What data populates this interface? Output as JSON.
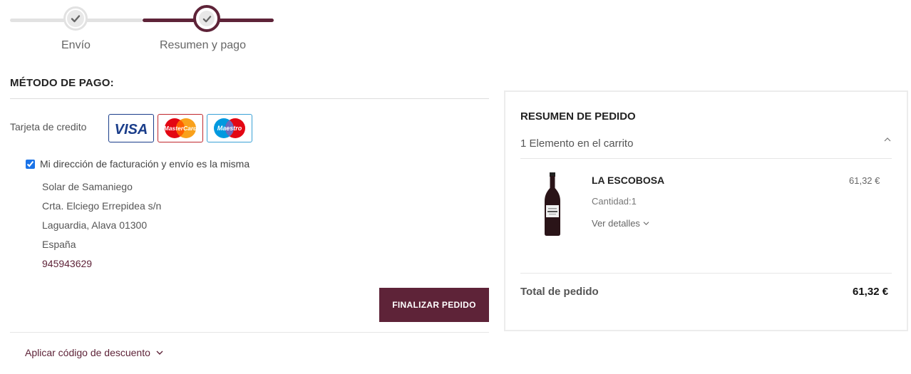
{
  "steps": [
    {
      "label": "Envío",
      "status": "complete",
      "icon": "check-icon"
    },
    {
      "label": "Resumen y pago",
      "status": "current",
      "icon": "check-icon"
    }
  ],
  "colors": {
    "accent": "#5e2338",
    "track_inactive": "#e2e2e2"
  },
  "payment": {
    "title": "MÉTODO DE PAGO:",
    "card_label": "Tarjeta de credito",
    "card_logos": {
      "visa": "VISA",
      "mastercard": "MasterCard",
      "maestro": "Maestro"
    },
    "same_address": {
      "label": "Mi dirección de facturación y envío es la misma",
      "checked": true
    },
    "address": {
      "name": "Solar de Samaniego",
      "street": "Crta. Elciego Errepidea s/n",
      "city": "Laguardia, Alava 01300",
      "country": "España",
      "phone": "945943629"
    },
    "finalize_label": "FINALIZAR PEDIDO",
    "discount_label": "Aplicar código de descuento"
  },
  "summary": {
    "title": "RESUMEN DE PEDIDO",
    "items_count": "1 Elemento en el carrito",
    "items": [
      {
        "name": "LA ESCOBOSA",
        "quantity": "Cantidad:1",
        "details_label": "Ver detalles",
        "price": "61,32 €"
      }
    ],
    "total_label": "Total de pedido",
    "total_value": "61,32 €"
  }
}
